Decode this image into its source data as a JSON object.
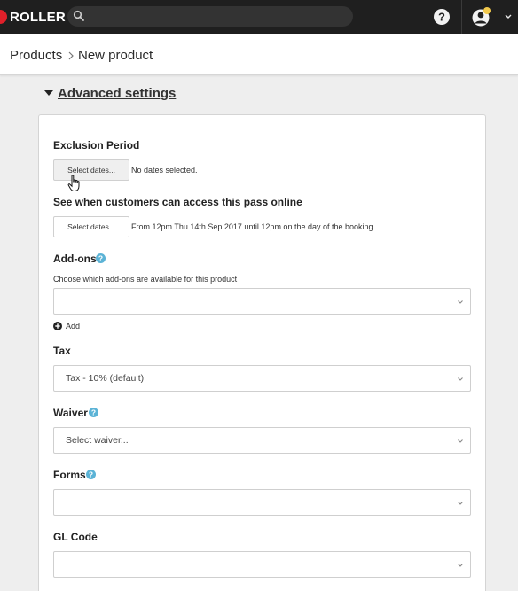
{
  "app": {
    "logo_text": "ROLLER"
  },
  "header": {
    "search_placeholder": "",
    "icons": [
      "search-icon",
      "help-icon",
      "avatar-icon",
      "chevron-down-icon"
    ]
  },
  "breadcrumb": {
    "root": "Products",
    "current": "New product"
  },
  "advanced": {
    "title": "Advanced settings"
  },
  "exclusion": {
    "label": "Exclusion Period",
    "button": "Select dates...",
    "status": "No dates selected."
  },
  "online_access": {
    "label": "See when customers can access this pass online",
    "button": "Select dates...",
    "status": "From 12pm Thu 14th Sep 2017 until 12pm on the day of the booking"
  },
  "addons": {
    "label": "Add-ons",
    "hint": "Choose which add-ons are available for this product",
    "value": "",
    "add_label": "Add"
  },
  "tax": {
    "label": "Tax",
    "value": "Tax - 10% (default)"
  },
  "waiver": {
    "label": "Waiver",
    "value": "Select waiver..."
  },
  "forms": {
    "label": "Forms",
    "value": ""
  },
  "gl_code": {
    "label": "GL Code",
    "value": ""
  },
  "colors": {
    "topbar": "#1f1f1f",
    "brand_red": "#e0202a",
    "info_blue": "#5bb3d6",
    "avatar_yellow": "#f2c94c"
  }
}
